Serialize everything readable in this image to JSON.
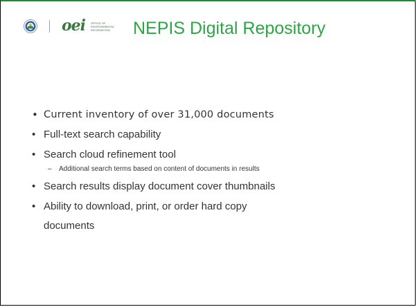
{
  "header": {
    "title": "NEPIS Digital Repository",
    "seal_icon": "epa-seal-icon",
    "logo": {
      "letters": "oei",
      "text_lines": [
        "OFFICE OF",
        "ENVIRONMENTAL",
        "INFORMATION"
      ]
    }
  },
  "bullets": [
    {
      "text": "Current inventory of over 31,000 documents"
    },
    {
      "text": "Full-text search capability"
    },
    {
      "text": "Search cloud refinement tool",
      "sub": "Additional search terms based on content of documents in results"
    },
    {
      "text": "Search results display document cover thumbnails"
    },
    {
      "text_line1": "Ability to download, print, or order hard copy",
      "text_line2": "documents"
    }
  ],
  "colors": {
    "title": "#2ea545",
    "top_rule": "#1f8a2e",
    "body_text": "#333333"
  }
}
